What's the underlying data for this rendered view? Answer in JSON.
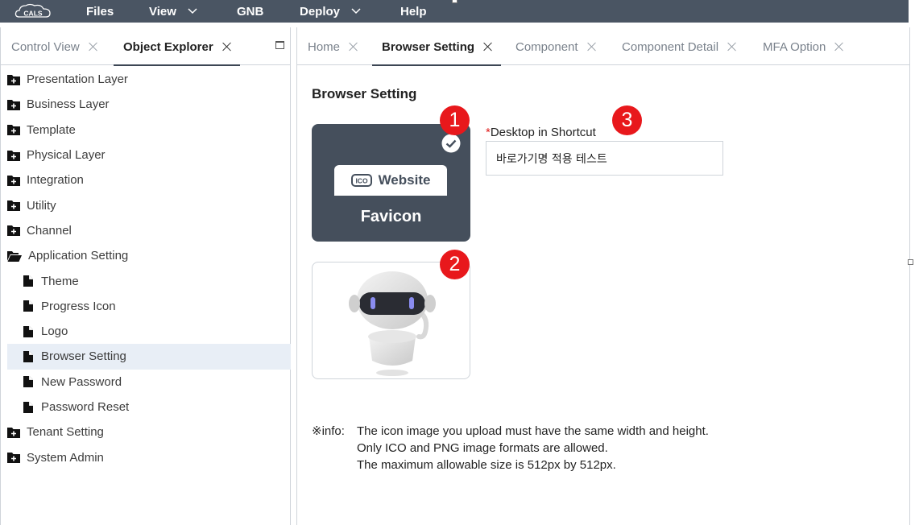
{
  "menubar": {
    "logo_text": "CALS",
    "items": [
      {
        "label": "Files",
        "has_dropdown": false
      },
      {
        "label": "View",
        "has_dropdown": true
      },
      {
        "label": "GNB",
        "has_dropdown": false
      },
      {
        "label": "Deploy",
        "has_dropdown": true
      },
      {
        "label": "Help",
        "has_dropdown": false
      }
    ]
  },
  "left_panel": {
    "tabs": [
      {
        "label": "Control View",
        "active": false
      },
      {
        "label": "Object Explorer",
        "active": true
      }
    ],
    "tree": [
      {
        "label": "Presentation Layer",
        "icon": "folder-plus-icon",
        "level": 0
      },
      {
        "label": "Business Layer",
        "icon": "folder-plus-icon",
        "level": 0
      },
      {
        "label": "Template",
        "icon": "folder-plus-icon",
        "level": 0
      },
      {
        "label": "Physical Layer",
        "icon": "folder-plus-icon",
        "level": 0
      },
      {
        "label": "Integration",
        "icon": "folder-plus-icon",
        "level": 0
      },
      {
        "label": "Utility",
        "icon": "folder-plus-icon",
        "level": 0
      },
      {
        "label": "Channel",
        "icon": "folder-plus-icon",
        "level": 0
      },
      {
        "label": "Application Setting",
        "icon": "folder-open-icon",
        "level": 0
      },
      {
        "label": "Theme",
        "icon": "file-icon",
        "level": 1
      },
      {
        "label": "Progress Icon",
        "icon": "file-icon",
        "level": 1
      },
      {
        "label": "Logo",
        "icon": "file-icon",
        "level": 1
      },
      {
        "label": "Browser Setting",
        "icon": "file-icon",
        "level": 1,
        "selected": true
      },
      {
        "label": "New Password",
        "icon": "file-icon",
        "level": 1
      },
      {
        "label": "Password Reset",
        "icon": "file-icon",
        "level": 1
      },
      {
        "label": "Tenant Setting",
        "icon": "folder-plus-icon",
        "level": 0
      },
      {
        "label": "System Admin",
        "icon": "folder-plus-icon",
        "level": 0
      }
    ]
  },
  "right_panel": {
    "tabs": [
      {
        "label": "Home",
        "active": false
      },
      {
        "label": "Browser Setting",
        "active": true
      },
      {
        "label": "Component",
        "active": false
      },
      {
        "label": "Component Detail",
        "active": false
      },
      {
        "label": "MFA Option",
        "active": false
      }
    ],
    "section_title": "Browser Setting",
    "favicon_card": {
      "pill_icon_text": "ICO",
      "pill_text": "Website",
      "label": "Favicon",
      "checked": true
    },
    "badges": [
      "1",
      "2",
      "3"
    ],
    "shortcut_field": {
      "required_mark": "*",
      "label": "Desktop in Shortcut",
      "value": "바로가기명 적용 테스트"
    },
    "info": {
      "prefix": "※info:",
      "lines": [
        "The icon image you upload must have the same width and height.",
        "Only ICO and PNG image formats are allowed.",
        "The maximum allowable size is 512px by 512px."
      ]
    }
  },
  "colors": {
    "menubar_bg": "#4a5563",
    "favicon_card_bg": "#454f5c",
    "badge": "#e8181c",
    "selected_row": "#e8eef6",
    "required_mark": "#e0201f"
  }
}
